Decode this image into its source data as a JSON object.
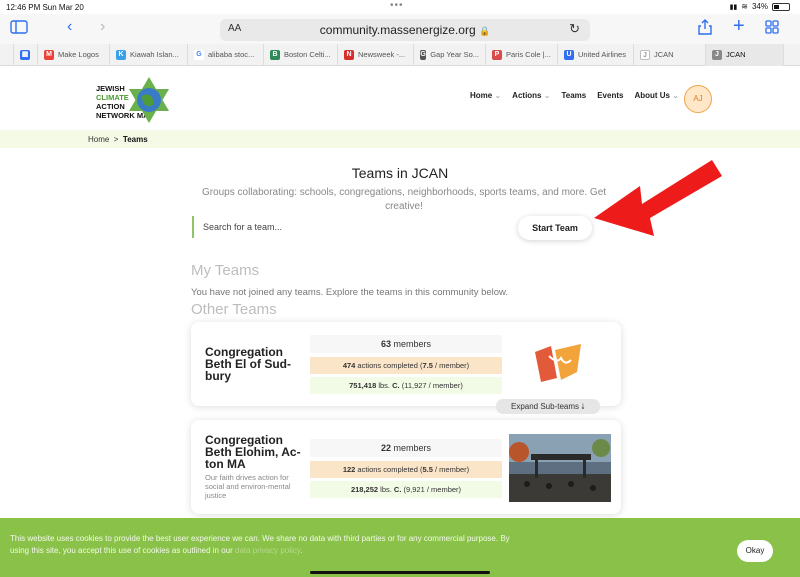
{
  "status": {
    "time": "12:46 PM  Sun Mar 20",
    "battery": "34%"
  },
  "browser": {
    "aa": "AA",
    "url": "community.massenergize.org",
    "bookmarks": [
      {
        "label": "Make Logos",
        "color": "#e9423a",
        "glyph": "M"
      },
      {
        "label": "Kiawah Islan...",
        "color": "#3aa0e9",
        "glyph": "K"
      },
      {
        "label": "alibaba stoc...",
        "color": "#4285f4",
        "glyph": "G"
      },
      {
        "label": "Boston Celti...",
        "color": "#2e8b57",
        "glyph": "B"
      },
      {
        "label": "Newsweek -...",
        "color": "#d62d2d",
        "glyph": "N"
      },
      {
        "label": "Gap Year So...",
        "color": "#555555",
        "glyph": "G"
      },
      {
        "label": "Paris Cole |...",
        "color": "#d94a4a",
        "glyph": "P"
      },
      {
        "label": "United Airlines",
        "color": "#2f6ff0",
        "glyph": "U"
      },
      {
        "label": "JCAN",
        "color": "#bbbbbb",
        "glyph": "J"
      },
      {
        "label": "JCAN",
        "color": "#888888",
        "glyph": "J"
      }
    ]
  },
  "site": {
    "logo": {
      "line1": "JEWISH",
      "line2": "CLIMATE",
      "line3": "ACTION",
      "line4": "NETWORK MA"
    },
    "nav": [
      {
        "label": "Home",
        "caret": true
      },
      {
        "label": "Actions",
        "caret": true
      },
      {
        "label": "Teams",
        "caret": false
      },
      {
        "label": "Events",
        "caret": false
      },
      {
        "label": "About Us",
        "caret": true
      }
    ],
    "avatar": "AJ"
  },
  "breadcrumb": {
    "home": "Home",
    "sep": ">",
    "current": "Teams"
  },
  "page": {
    "title": "Teams in JCAN",
    "subtitle": "Groups collaborating: schools, congregations, neighborhoods, sports teams, and more. Get creative!",
    "search_placeholder": "Search for a team...",
    "start_team": "Start Team",
    "my_teams": "My Teams",
    "no_teams": "You have not joined any teams. Explore the teams in this community below.",
    "other_teams": "Other Teams",
    "expand": "Expand Sub-teams ⭣"
  },
  "teams": [
    {
      "name": "Congregation Beth El of Sud-bury",
      "description": "",
      "members_count": "63",
      "members_word": "members",
      "actions_count": "474",
      "actions_text": "actions completed (",
      "actions_per": "7.5",
      "actions_tail": " / member)",
      "carbon_amount": "751,418",
      "carbon_unit": "lbs. C.",
      "carbon_per": "(11,927",
      "carbon_tail": " / member)"
    },
    {
      "name": "Congregation Beth Elohim, Ac-ton MA",
      "description": "Our faith drives action for social and environ-mental justice",
      "members_count": "22",
      "members_word": "members",
      "actions_count": "122",
      "actions_text": "actions completed (",
      "actions_per": "5.5",
      "actions_tail": " / member)",
      "carbon_amount": "218,252",
      "carbon_unit": "lbs. C.",
      "carbon_per": "(9,921",
      "carbon_tail": " / member)"
    }
  ],
  "cookie": {
    "text": "This website uses cookies to provide the best user experience we can. We share no data with third parties or for any commercial purpose. By using this site, you accept this use of cookies as outlined in our ",
    "link": "data privacy policy",
    "end": ".",
    "okay": "Okay"
  },
  "colors": {
    "accent_green": "#89c149",
    "arrow_red": "#ee1b1b"
  }
}
